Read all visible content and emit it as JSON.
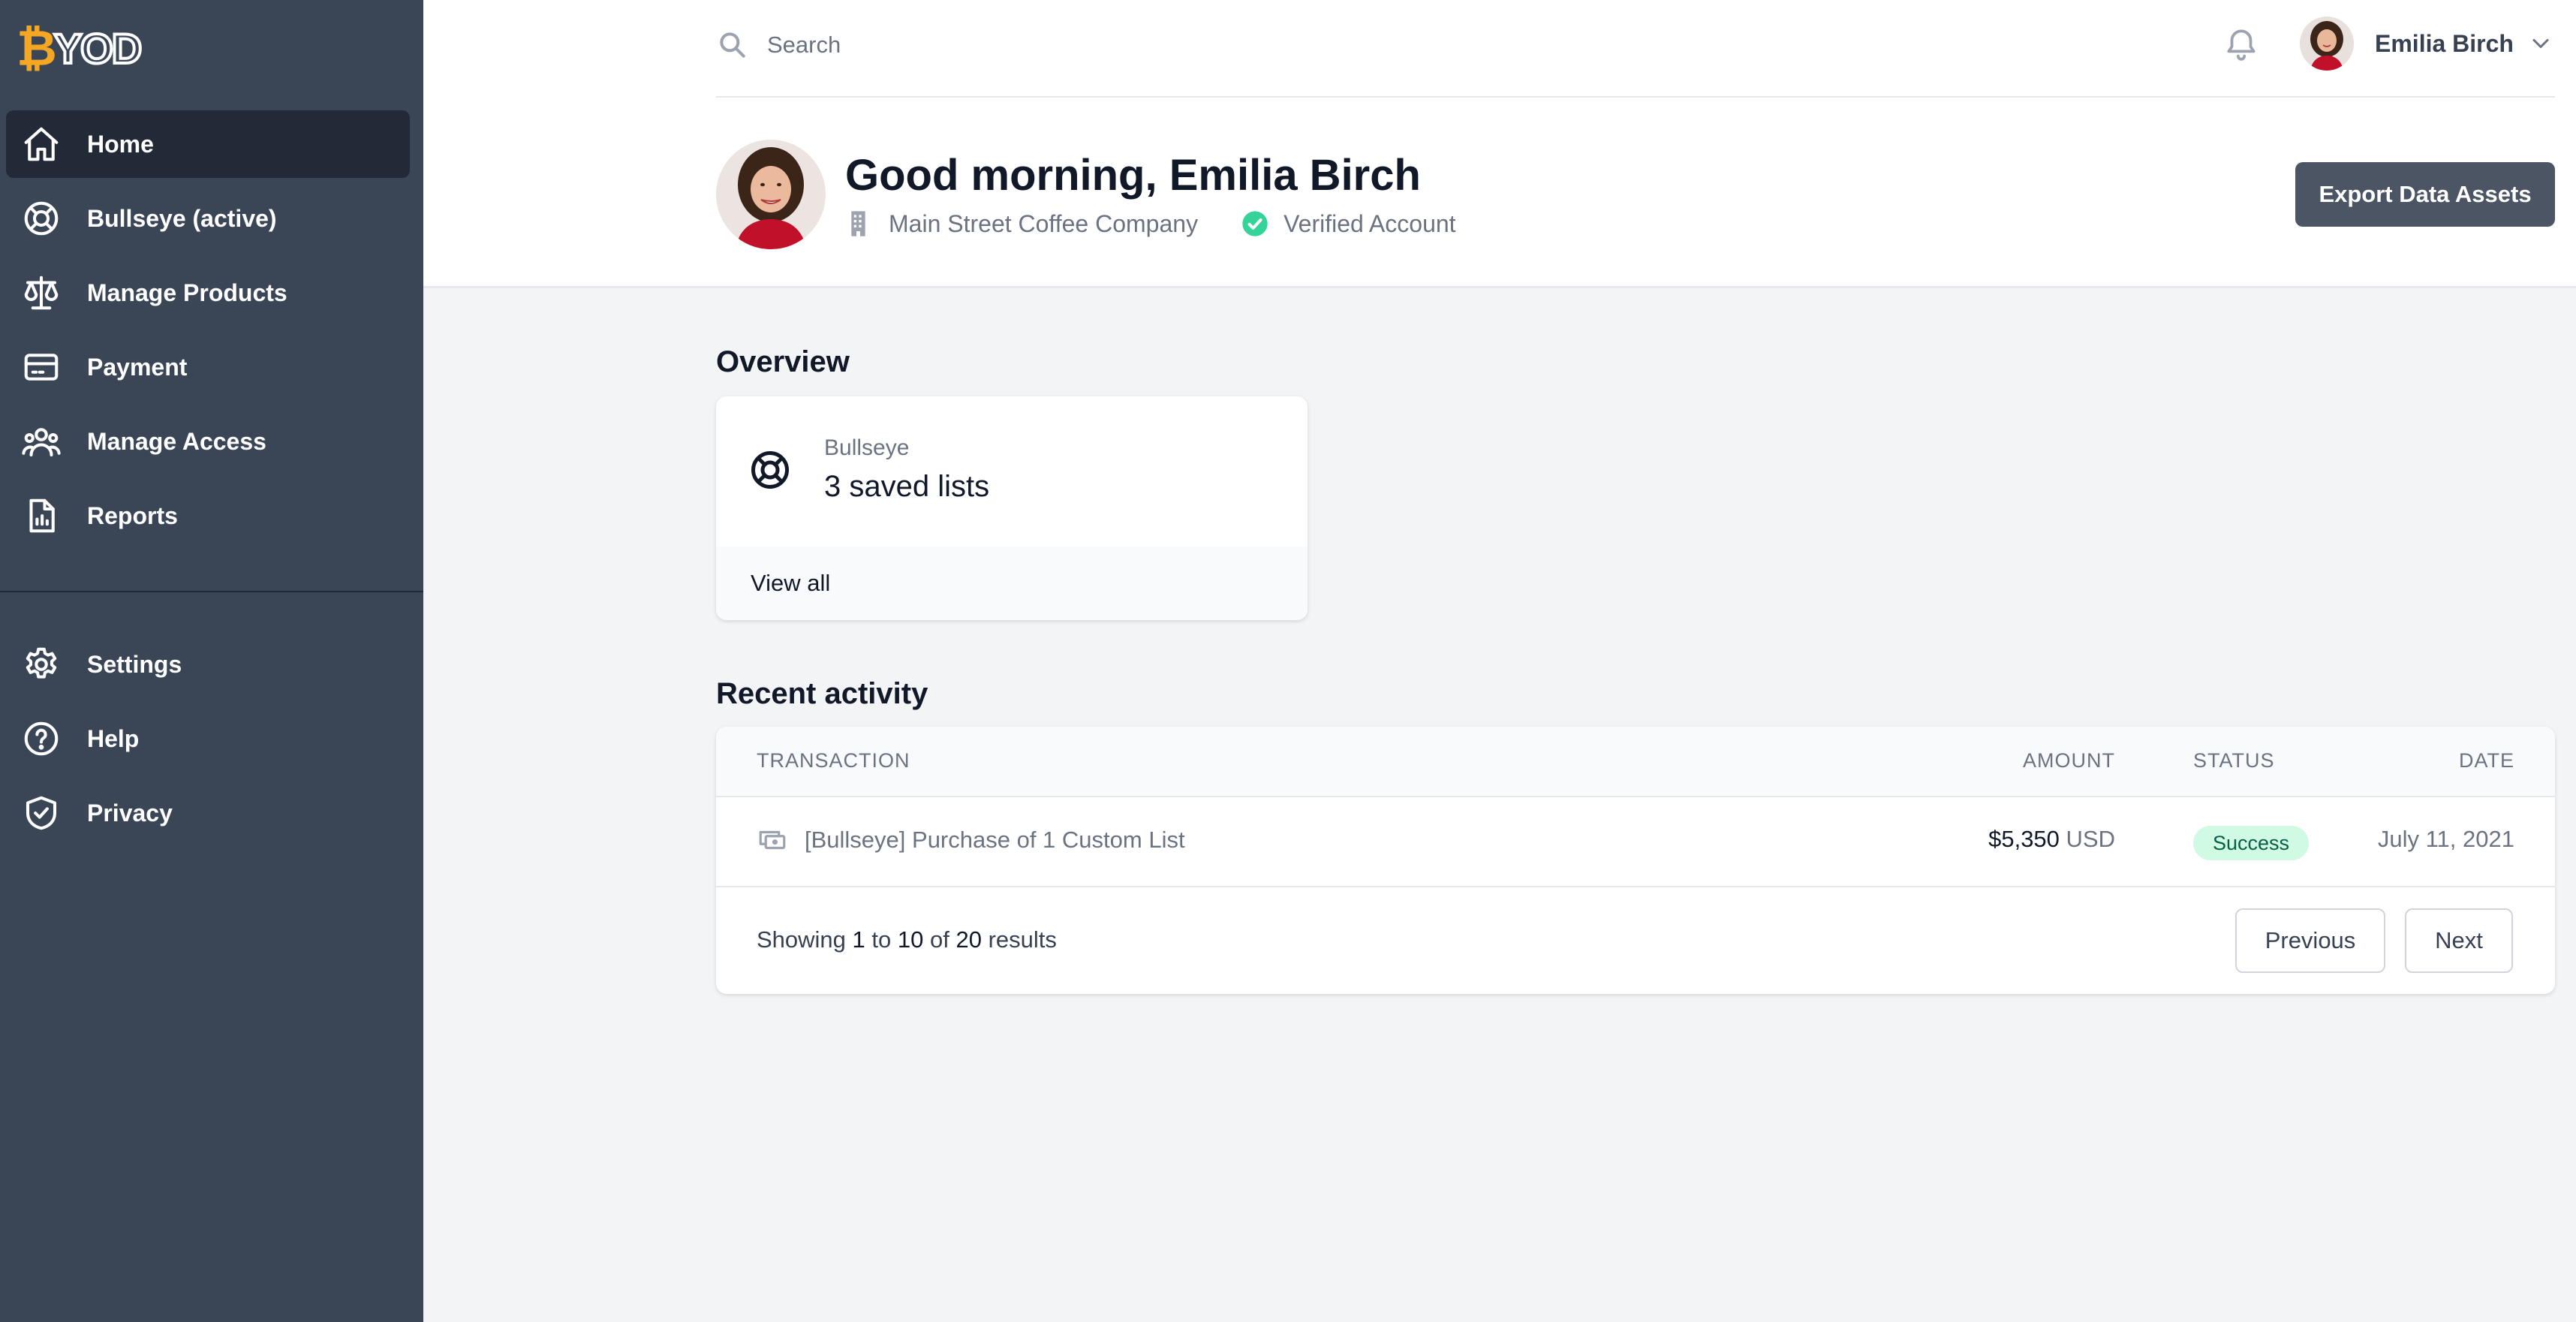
{
  "brand": {
    "logo_b": "₿",
    "logo_rest": "YOD"
  },
  "sidebar": {
    "main_items": [
      {
        "label": "Home",
        "icon": "home-icon",
        "active": true
      },
      {
        "label": "Bullseye (active)",
        "icon": "lifebuoy-icon",
        "active": false
      },
      {
        "label": "Manage Products",
        "icon": "scale-icon",
        "active": false
      },
      {
        "label": "Payment",
        "icon": "credit-card-icon",
        "active": false
      },
      {
        "label": "Manage Access",
        "icon": "user-group-icon",
        "active": false
      },
      {
        "label": "Reports",
        "icon": "document-report-icon",
        "active": false
      }
    ],
    "secondary_items": [
      {
        "label": "Settings",
        "icon": "gear-icon"
      },
      {
        "label": "Help",
        "icon": "question-circle-icon"
      },
      {
        "label": "Privacy",
        "icon": "shield-check-icon"
      }
    ]
  },
  "topbar": {
    "search_placeholder": "Search",
    "user_name": "Emilia Birch"
  },
  "header": {
    "greeting": "Good morning, Emilia Birch",
    "company": "Main Street Coffee Company",
    "verified": "Verified Account",
    "export_label": "Export Data Assets"
  },
  "overview": {
    "title": "Overview",
    "card": {
      "label": "Bullseye",
      "value": "3 saved lists",
      "link": "View all"
    }
  },
  "activity": {
    "title": "Recent activity",
    "columns": {
      "transaction": "TRANSACTION",
      "amount": "AMOUNT",
      "status": "STATUS",
      "date": "DATE"
    },
    "rows": [
      {
        "transaction": "[Bullseye] Purchase of 1 Custom List",
        "amount": "$5,350",
        "currency": "USD",
        "status": "Success",
        "date": "July 11, 2021"
      }
    ],
    "pager": {
      "showing": "Showing",
      "from": "1",
      "to_word": "to",
      "to": "10",
      "of_word": "of",
      "total": "20",
      "results_word": "results",
      "prev": "Previous",
      "next": "Next"
    }
  },
  "colors": {
    "sidebar_bg": "#3a4556",
    "sidebar_active": "#222a37",
    "logo_accent": "#f5a623",
    "verified_green": "#34d399",
    "success_badge_bg": "#d1fae5",
    "success_badge_text": "#065f46",
    "export_button": "#4b5563"
  }
}
